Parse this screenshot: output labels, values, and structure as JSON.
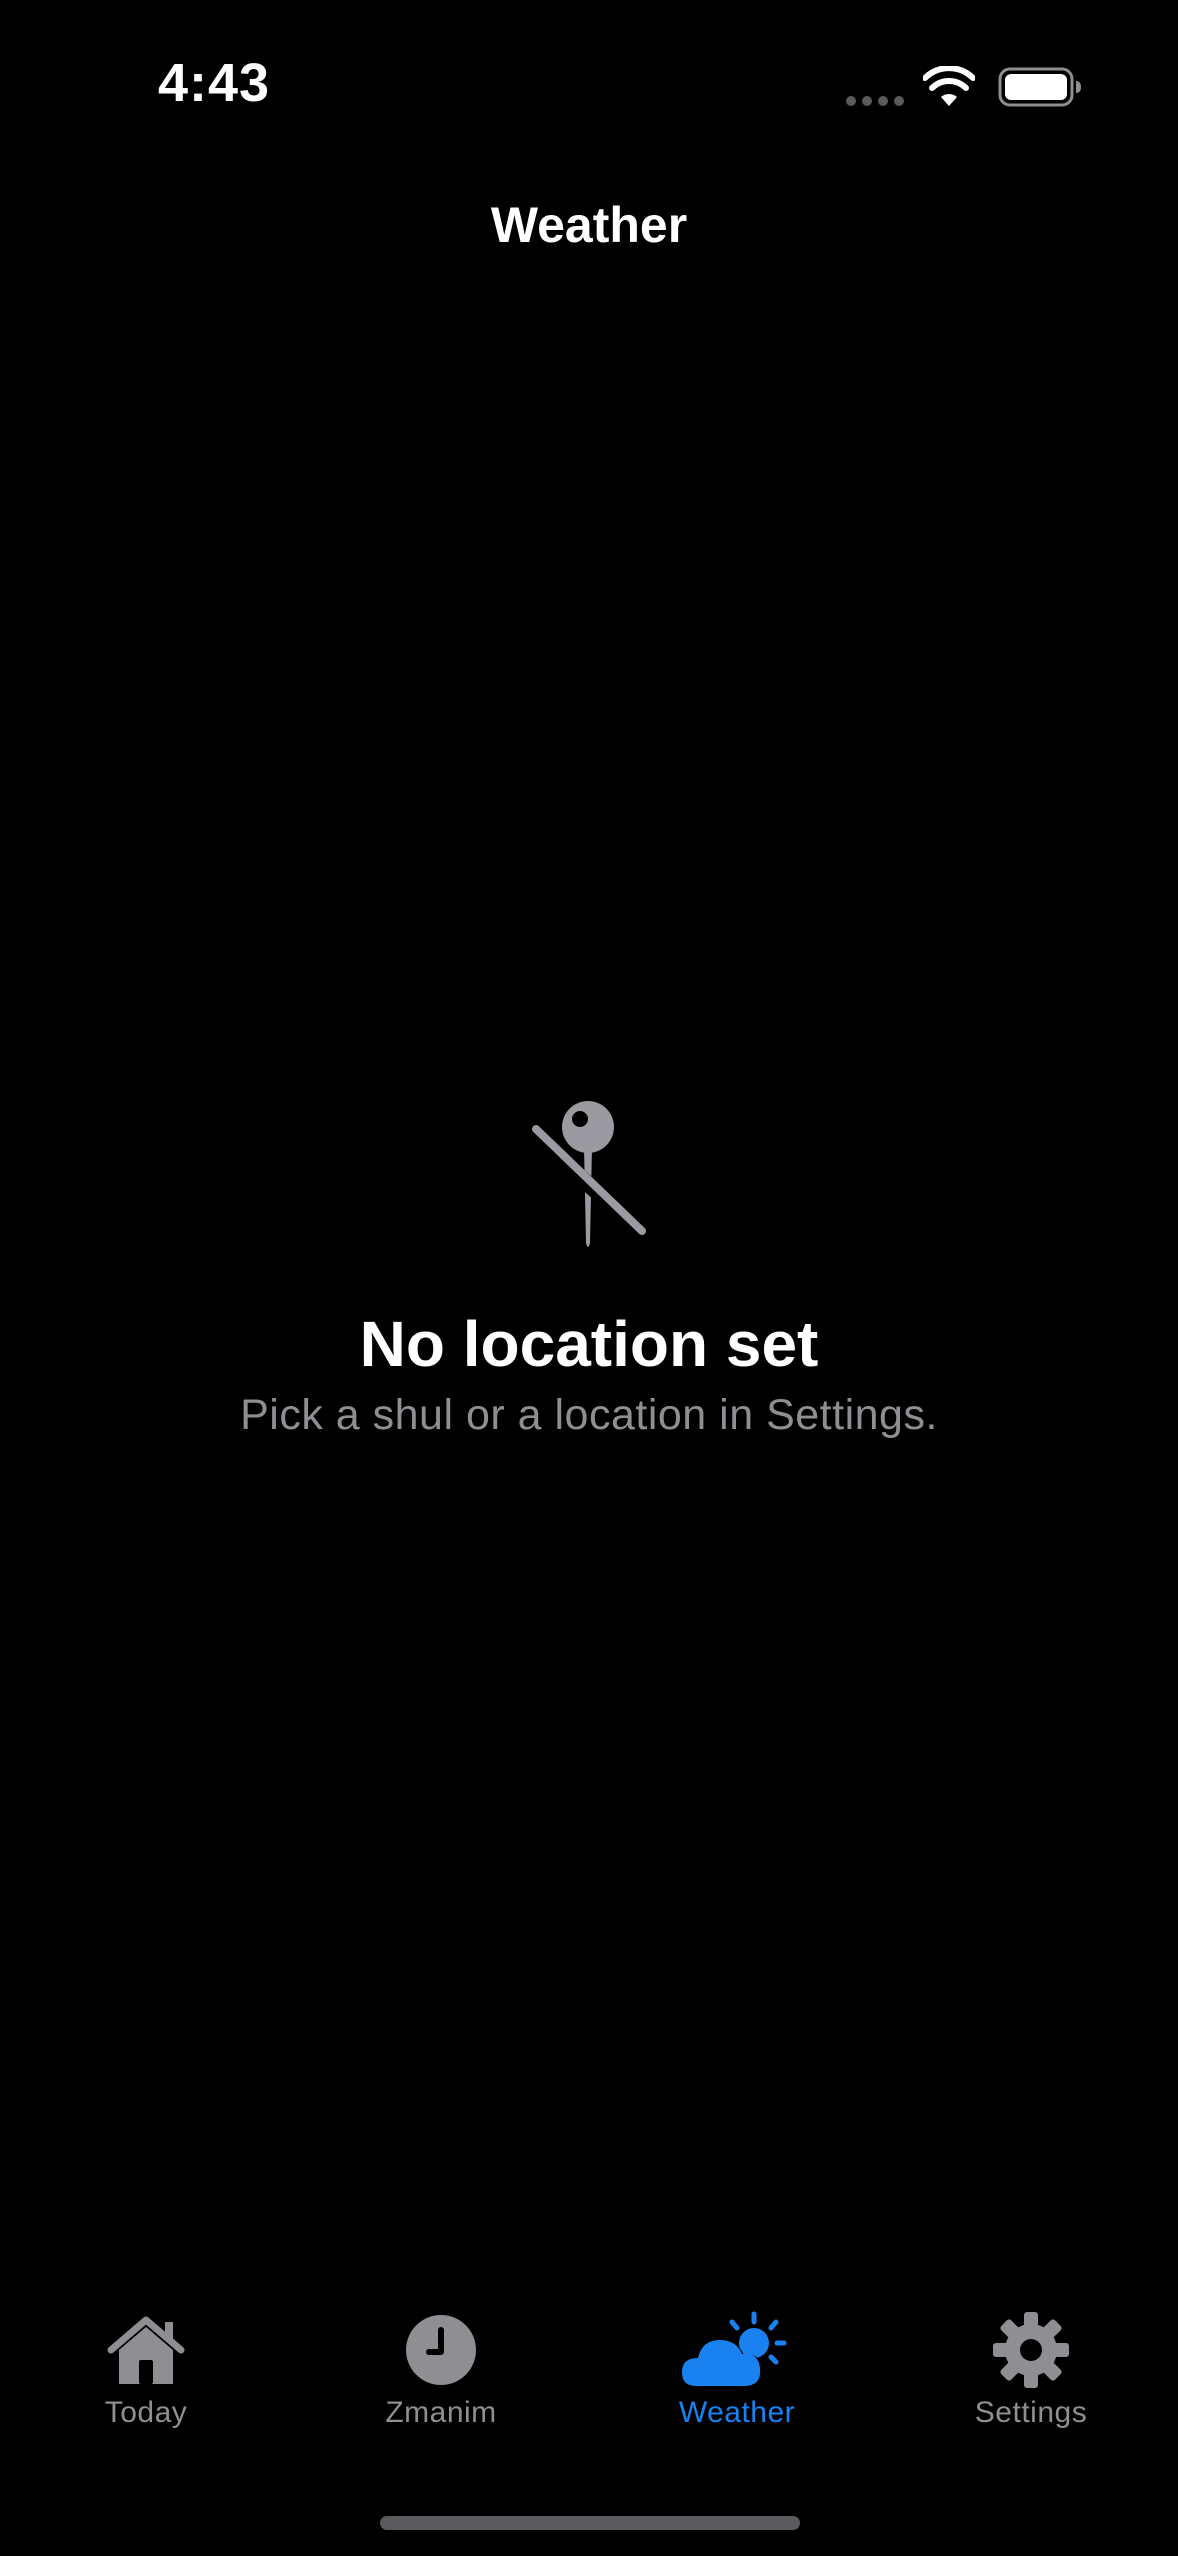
{
  "status_bar": {
    "time": "4:43"
  },
  "nav": {
    "title": "Weather"
  },
  "empty_state": {
    "icon": "location-slash-icon",
    "title": "No location set",
    "subtitle": "Pick a shul or a location in Settings."
  },
  "tab_bar": {
    "selected": "Weather",
    "tabs": [
      {
        "label": "Today",
        "icon": "house-icon"
      },
      {
        "label": "Zmanim",
        "icon": "clock-icon"
      },
      {
        "label": "Weather",
        "icon": "cloud-sun-icon"
      },
      {
        "label": "Settings",
        "icon": "gear-icon"
      }
    ]
  },
  "colors": {
    "background": "#000000",
    "accent": "#1a82f0",
    "inactive": "#8e8e93",
    "text": "#ffffff"
  }
}
